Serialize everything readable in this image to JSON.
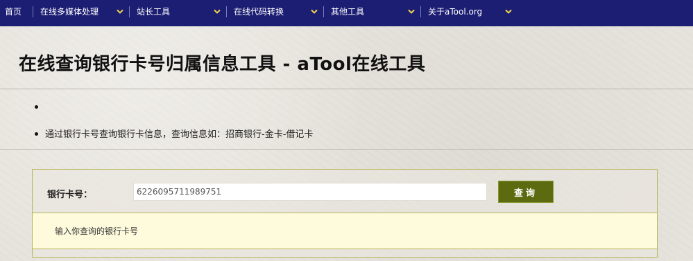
{
  "nav": {
    "home": "首页",
    "items": [
      {
        "label": "在线多媒体处理"
      },
      {
        "label": "站长工具"
      },
      {
        "label": "在线代码转换"
      },
      {
        "label": "其他工具"
      },
      {
        "label": "关于aTool.org"
      }
    ]
  },
  "page": {
    "title": "在线查询银行卡号归属信息工具 - aTool在线工具"
  },
  "bullets": [
    "",
    "通过银行卡号查询银行卡信息，查询信息如：招商银行-金卡-借记卡"
  ],
  "form": {
    "label": "银行卡号：",
    "card_value": "6226095711989751",
    "button_label": "查询"
  },
  "result": {
    "hint": "输入你查询的银行卡号"
  },
  "colors": {
    "nav_bg": "#1c1e74",
    "button_bg": "#5c6b10",
    "panel_border": "#b7b458",
    "result_bg": "#fdfbdc"
  }
}
